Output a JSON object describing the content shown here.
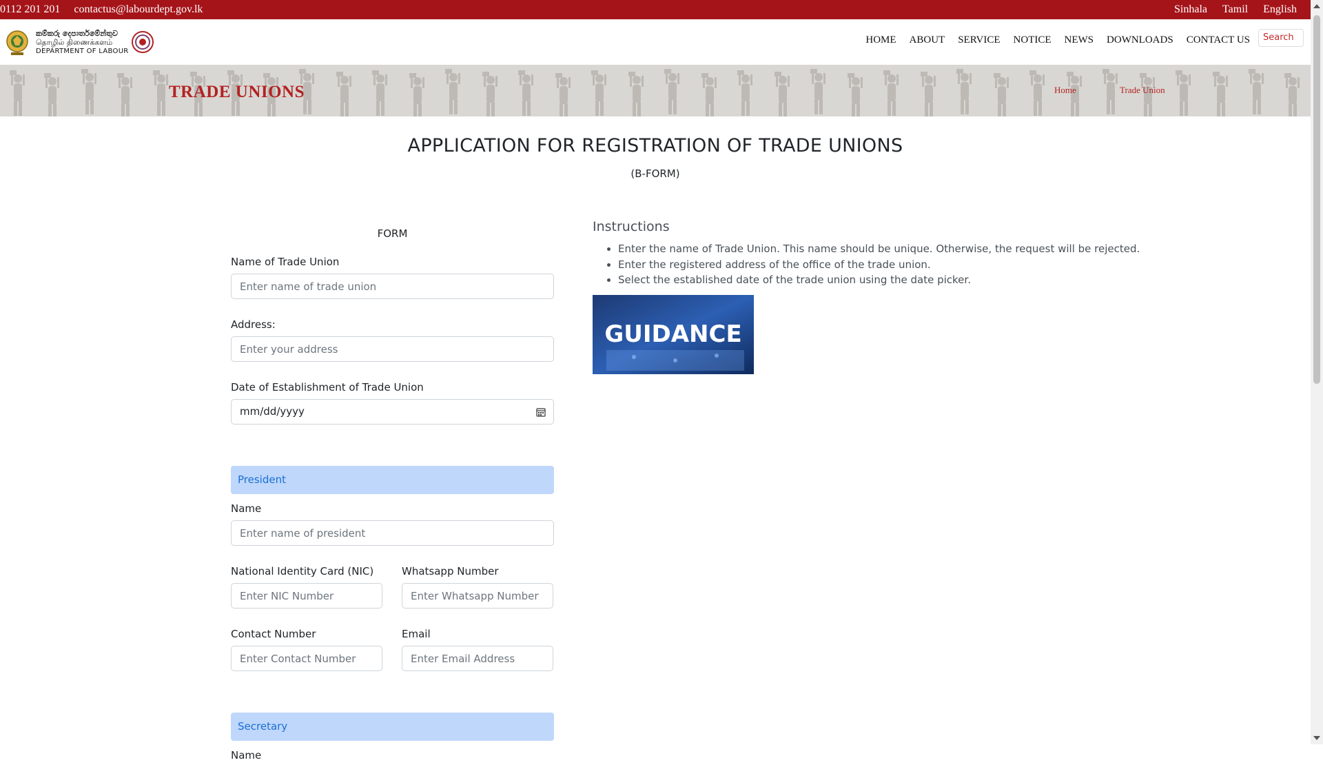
{
  "topbar": {
    "phone": "0112 201 201",
    "email": "contactus@labourdept.gov.lk",
    "languages": [
      "Sinhala",
      "Tamil",
      "English"
    ]
  },
  "header": {
    "logo_line1": "කම්කරු දෙපාර්තමේන්තුව",
    "logo_line2": "தொழில் திணைக்களம்",
    "logo_line3": "DEPARTMENT OF LABOUR",
    "nav": [
      "HOME",
      "ABOUT",
      "SERVICE",
      "NOTICE",
      "NEWS",
      "DOWNLOADS",
      "CONTACT US"
    ],
    "search_placeholder": "Search"
  },
  "banner": {
    "title": "TRADE UNIONS",
    "breadcrumb": [
      "Home",
      "Trade Union"
    ]
  },
  "main": {
    "title": "APPLICATION FOR REGISTRATION OF TRADE UNIONS",
    "subtitle": "(B-FORM)"
  },
  "form": {
    "heading": "FORM",
    "union_name_label": "Name of Trade Union",
    "union_name_placeholder": "Enter name of trade union",
    "address_label": "Address:",
    "address_placeholder": "Enter your address",
    "date_label": "Date of Establishment of Trade Union",
    "date_placeholder": "mm/dd/yyyy",
    "president": {
      "section": "President",
      "name_label": "Name",
      "name_placeholder": "Enter name of president",
      "nic_label": "National Identity Card (NIC)",
      "nic_placeholder": "Enter NIC Number",
      "whatsapp_label": "Whatsapp Number",
      "whatsapp_placeholder": "Enter Whatsapp Number",
      "contact_label": "Contact Number",
      "contact_placeholder": "Enter Contact Number",
      "email_label": "Email",
      "email_placeholder": "Enter Email Address"
    },
    "secretary": {
      "section": "Secretary",
      "name_label": "Name"
    }
  },
  "instructions": {
    "heading": "Instructions",
    "items": [
      "Enter the name of Trade Union. This name should be unique. Otherwise, the request will be rejected.",
      "Enter the registered address of the office of the trade union.",
      "Select the established date of the trade union using the date picker."
    ],
    "guidance_text": "GUIDANCE"
  },
  "colors": {
    "topbar": "#a51419",
    "brand_red": "#b22222",
    "section_bg": "#bfd7fb",
    "section_text": "#1a6fd4"
  }
}
